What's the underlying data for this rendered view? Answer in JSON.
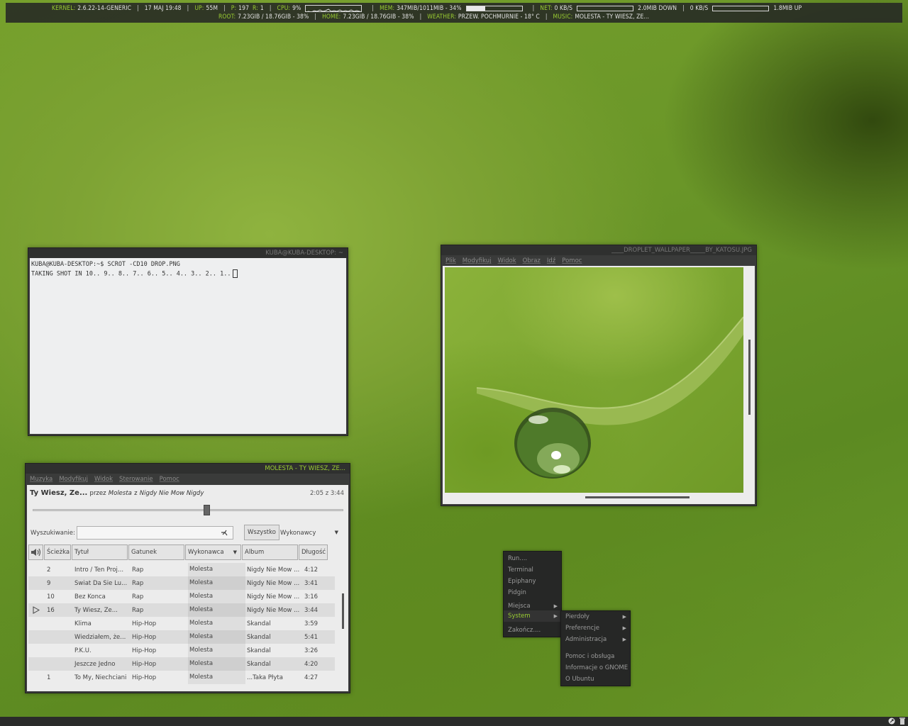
{
  "conky": {
    "kernel_label": "KERNEL:",
    "kernel_value": "2.6.22-14-GENERIC",
    "date": "17 MAJ 19:48",
    "up_label": "UP:",
    "up_value": "55M",
    "p_label": "P:",
    "p_value": "197",
    "r_label": "R:",
    "r_value": "1",
    "cpu_label": "CPU:",
    "cpu_value": "9%",
    "mem_label": "MEM:",
    "mem_value": "347MIB/1011MIB - 34%",
    "mem_fraction": 0.34,
    "net_label": "NET:",
    "net_down": "0 KB/S",
    "down_total": "2.0MIB DOWN",
    "net_up": "0 KB/S",
    "up_total": "1.8MIB UP",
    "root_label": "ROOT:",
    "root_value": "7.23GIB  / 18.76GIB - 38%",
    "home_label": "HOME:",
    "home_value": "7.23GIB  / 18.76GIB - 38%",
    "weather_label": "WEATHER:",
    "weather_value": "PRZEW. POCHMURNIE - 18° C",
    "music_label": "MUSIC:",
    "music_value": "MOLESTA - TY WIESZ, ZE..."
  },
  "terminal": {
    "title": "KUBA@KUBA-DESKTOP: ~",
    "line1": "KUBA@KUBA-DESKTOP:~$ SCROT -CD10 DROP.PNG",
    "line2": "TAKING SHOT IN 10.. 9.. 8.. 7.. 6.. 5.. 4.. 3.. 2.. 1.."
  },
  "viewer": {
    "title": "____DROPLET_WALLPAPER_____BY_KATOSU.JPG",
    "menu": [
      "Plik",
      "Modyfikuj",
      "Widok",
      "Obraz",
      "Idź",
      "Pomoc"
    ]
  },
  "player": {
    "title": "MOLESTA - TY WIESZ, ZE...",
    "menu": [
      "Muzyka",
      "Modyfikuj",
      "Widok",
      "Sterowanie",
      "Pomoc"
    ],
    "song": "Ty Wiesz, Ze...",
    "by": "przez",
    "artist": "Molesta",
    "from": "z",
    "album": "Nigdy Nie Mow Nigdy",
    "time": "2:05 z 3:44",
    "progress": 0.56,
    "search_label": "Wyszukiwanie:",
    "search_value": "",
    "all_button": "Wszystko",
    "filter_value": "Wykonawcy",
    "columns": [
      "Ścieżka",
      "Tytuł",
      "Gatunek",
      "Wykonawca",
      "Album",
      "Długość"
    ],
    "rows": [
      {
        "track": "2",
        "title": "Intro / Ten Proj...",
        "genre": "Rap",
        "artist": "Molesta",
        "album": "Nigdy Nie Mow ...",
        "length": "4:12"
      },
      {
        "track": "9",
        "title": "Swiat Da Sie Lu...",
        "genre": "Rap",
        "artist": "Molesta",
        "album": "Nigdy Nie Mow ...",
        "length": "3:41"
      },
      {
        "track": "10",
        "title": "Bez Konca",
        "genre": "Rap",
        "artist": "Molesta",
        "album": "Nigdy Nie Mow ...",
        "length": "3:16"
      },
      {
        "track": "16",
        "title": "Ty Wiesz, Ze...",
        "genre": "Rap",
        "artist": "Molesta",
        "album": "Nigdy Nie Mow ...",
        "length": "3:44",
        "playing": true
      },
      {
        "track": "",
        "title": "Klima",
        "genre": "Hip-Hop",
        "artist": "Molesta",
        "album": "Skandal",
        "length": "3:59"
      },
      {
        "track": "",
        "title": "Wiedziałem, że...",
        "genre": "Hip-Hop",
        "artist": "Molesta",
        "album": "Skandal",
        "length": "5:41"
      },
      {
        "track": "",
        "title": "P.K.U.",
        "genre": "Hip-Hop",
        "artist": "Molesta",
        "album": "Skandal",
        "length": "3:26"
      },
      {
        "track": "",
        "title": "Jeszcze Jedno",
        "genre": "Hip-Hop",
        "artist": "Molesta",
        "album": "Skandal",
        "length": "4:20"
      },
      {
        "track": "1",
        "title": "To My, Niechciani",
        "genre": "Hip-Hop",
        "artist": "Molesta",
        "album": "...Taka Płyta",
        "length": "4:27"
      }
    ]
  },
  "main_menu": {
    "items": [
      "Run....",
      "Terminal",
      "Epiphany",
      "Pidgin"
    ],
    "places": "Miejsca",
    "system": "System",
    "quit": "Zakończ...."
  },
  "system_menu": {
    "items": [
      "Pierdoły",
      "Preferencje",
      "Administracja"
    ],
    "extra": [
      "Pomoc i obsługa",
      "Informacje o GNOME",
      "O Ubuntu"
    ]
  },
  "colors": {
    "accent": "#9acd32",
    "panel": "#2a2b2a"
  }
}
